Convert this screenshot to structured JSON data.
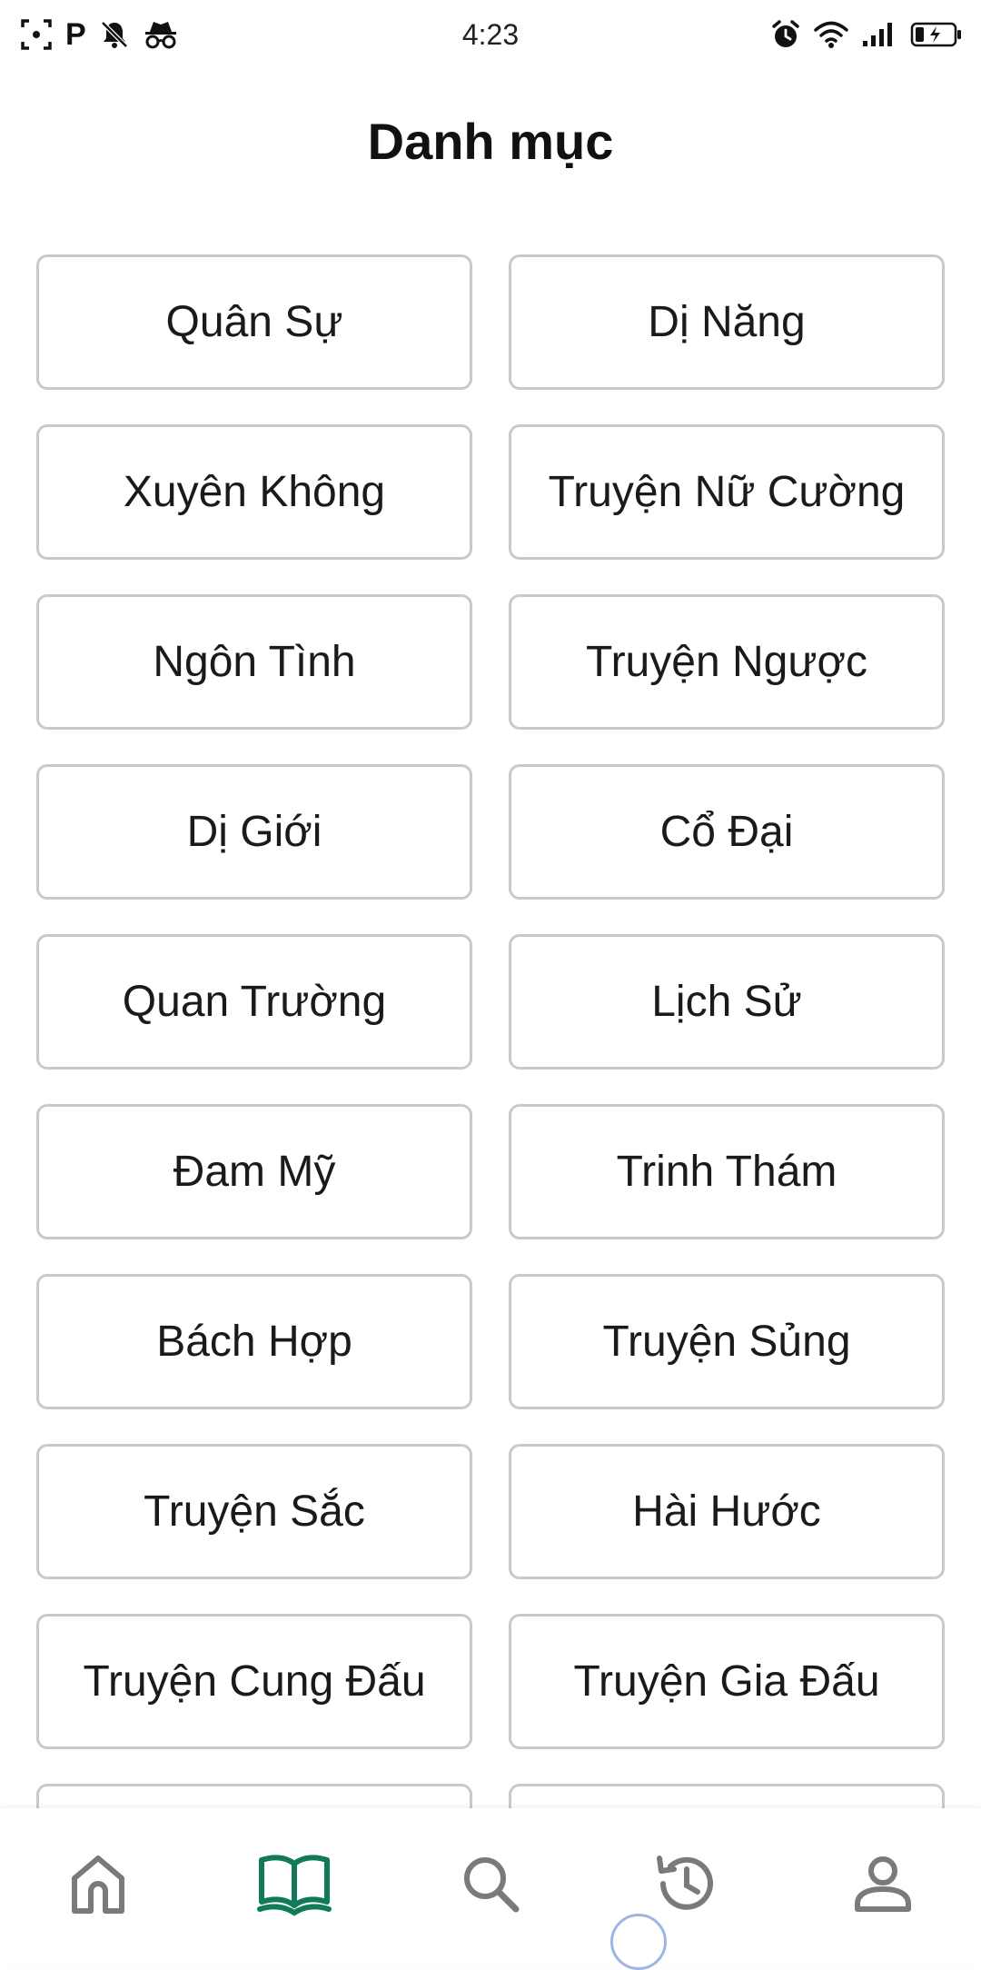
{
  "status_bar": {
    "time": "4:23",
    "left_icons": [
      "screenshot-icon",
      "p-app-icon",
      "bell-off-icon",
      "incognito-icon"
    ],
    "p_letter": "P",
    "right_icons": [
      "alarm-icon",
      "wifi-icon",
      "signal-icon",
      "battery-charging-icon"
    ]
  },
  "header": {
    "title": "Danh mục"
  },
  "categories": [
    "Quân Sự",
    "Dị Năng",
    "Xuyên Không",
    "Truyện Nữ Cường",
    "Ngôn Tình",
    "Truyện Ngược",
    "Dị Giới",
    "Cổ Đại",
    "Quan Trường",
    "Lịch Sử",
    "Đam Mỹ",
    "Trinh Thám",
    "Bách Hợp",
    "Truyện Sủng",
    "Truyện Sắc",
    "Hài Hước",
    "Truyện Cung Đấu",
    "Truyện Gia Đấu",
    "",
    ""
  ],
  "bottom_nav": {
    "items": [
      {
        "icon": "home-icon",
        "active": false
      },
      {
        "icon": "book-open-icon",
        "active": true
      },
      {
        "icon": "search-icon",
        "active": false
      },
      {
        "icon": "history-icon",
        "active": false
      },
      {
        "icon": "profile-icon",
        "active": false
      }
    ],
    "active_color": "#117a5a",
    "inactive_color": "#7a7a7a"
  },
  "colors": {
    "button_border": "#c9c9c9",
    "title_text": "#111111"
  }
}
